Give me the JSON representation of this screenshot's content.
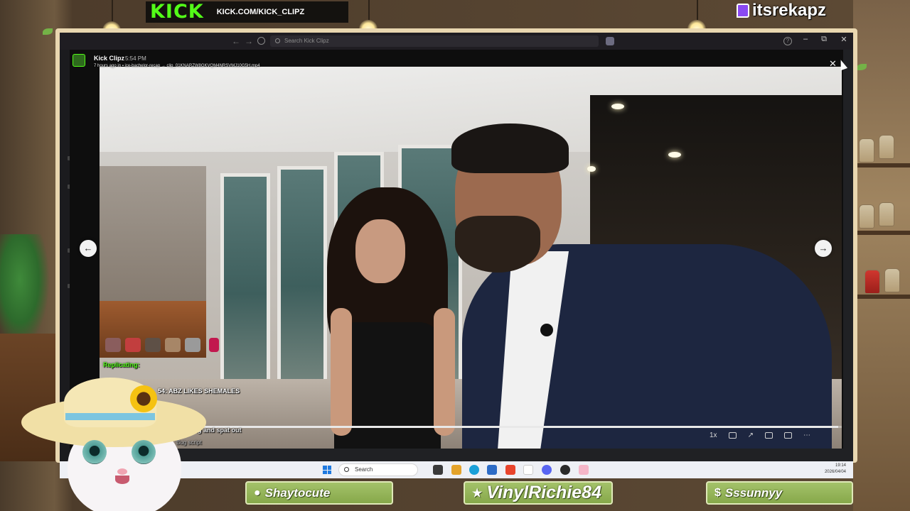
{
  "overlay": {
    "banner_logo": "KICK",
    "banner_url": "KICK.COM/KICK_CLIPZ",
    "twitch_handle": "itsrekapz"
  },
  "window": {
    "search_placeholder": "Search Kick Clipz",
    "controls": {
      "minimize": "–",
      "maximize": "⧉",
      "close": "✕"
    }
  },
  "clip": {
    "channel": "Kick Clipz",
    "time": "5:54 PM",
    "meta": "7 hours ago in ▪ ice-bachelor-recap → clip_01KNARZW8GKVQM4NRSVMJ10G5H.mp4",
    "progress_fraction": 0.995,
    "speed": "1x",
    "controls": [
      "1x",
      "⌄",
      "captions-icon",
      "pop-out-icon",
      "sidebar-icon",
      "pip-icon",
      "more-icon"
    ]
  },
  "chat": {
    "emote_counts": [
      "x5",
      "x5"
    ],
    "lines": [
      {
        "text": "Replicating:",
        "color": "#53fc18"
      },
      {
        "text": "54: ABZ LIKES SHEMALES",
        "color": "#ffffff"
      },
      {
        "text": "ating and spat out",
        "color": "#e8e8e8"
      },
      {
        "text": "Bug script",
        "color": "#bdbdbd"
      }
    ]
  },
  "taskbar": {
    "search_label": "Search",
    "time": "19:14",
    "date": "2026/04/04"
  },
  "badges": [
    {
      "icon": "person-icon",
      "label": "Shaytocute"
    },
    {
      "icon": "star-icon",
      "label": "VinylRichie84"
    },
    {
      "icon": "dollar-icon",
      "label": "Sssunnyy"
    }
  ]
}
